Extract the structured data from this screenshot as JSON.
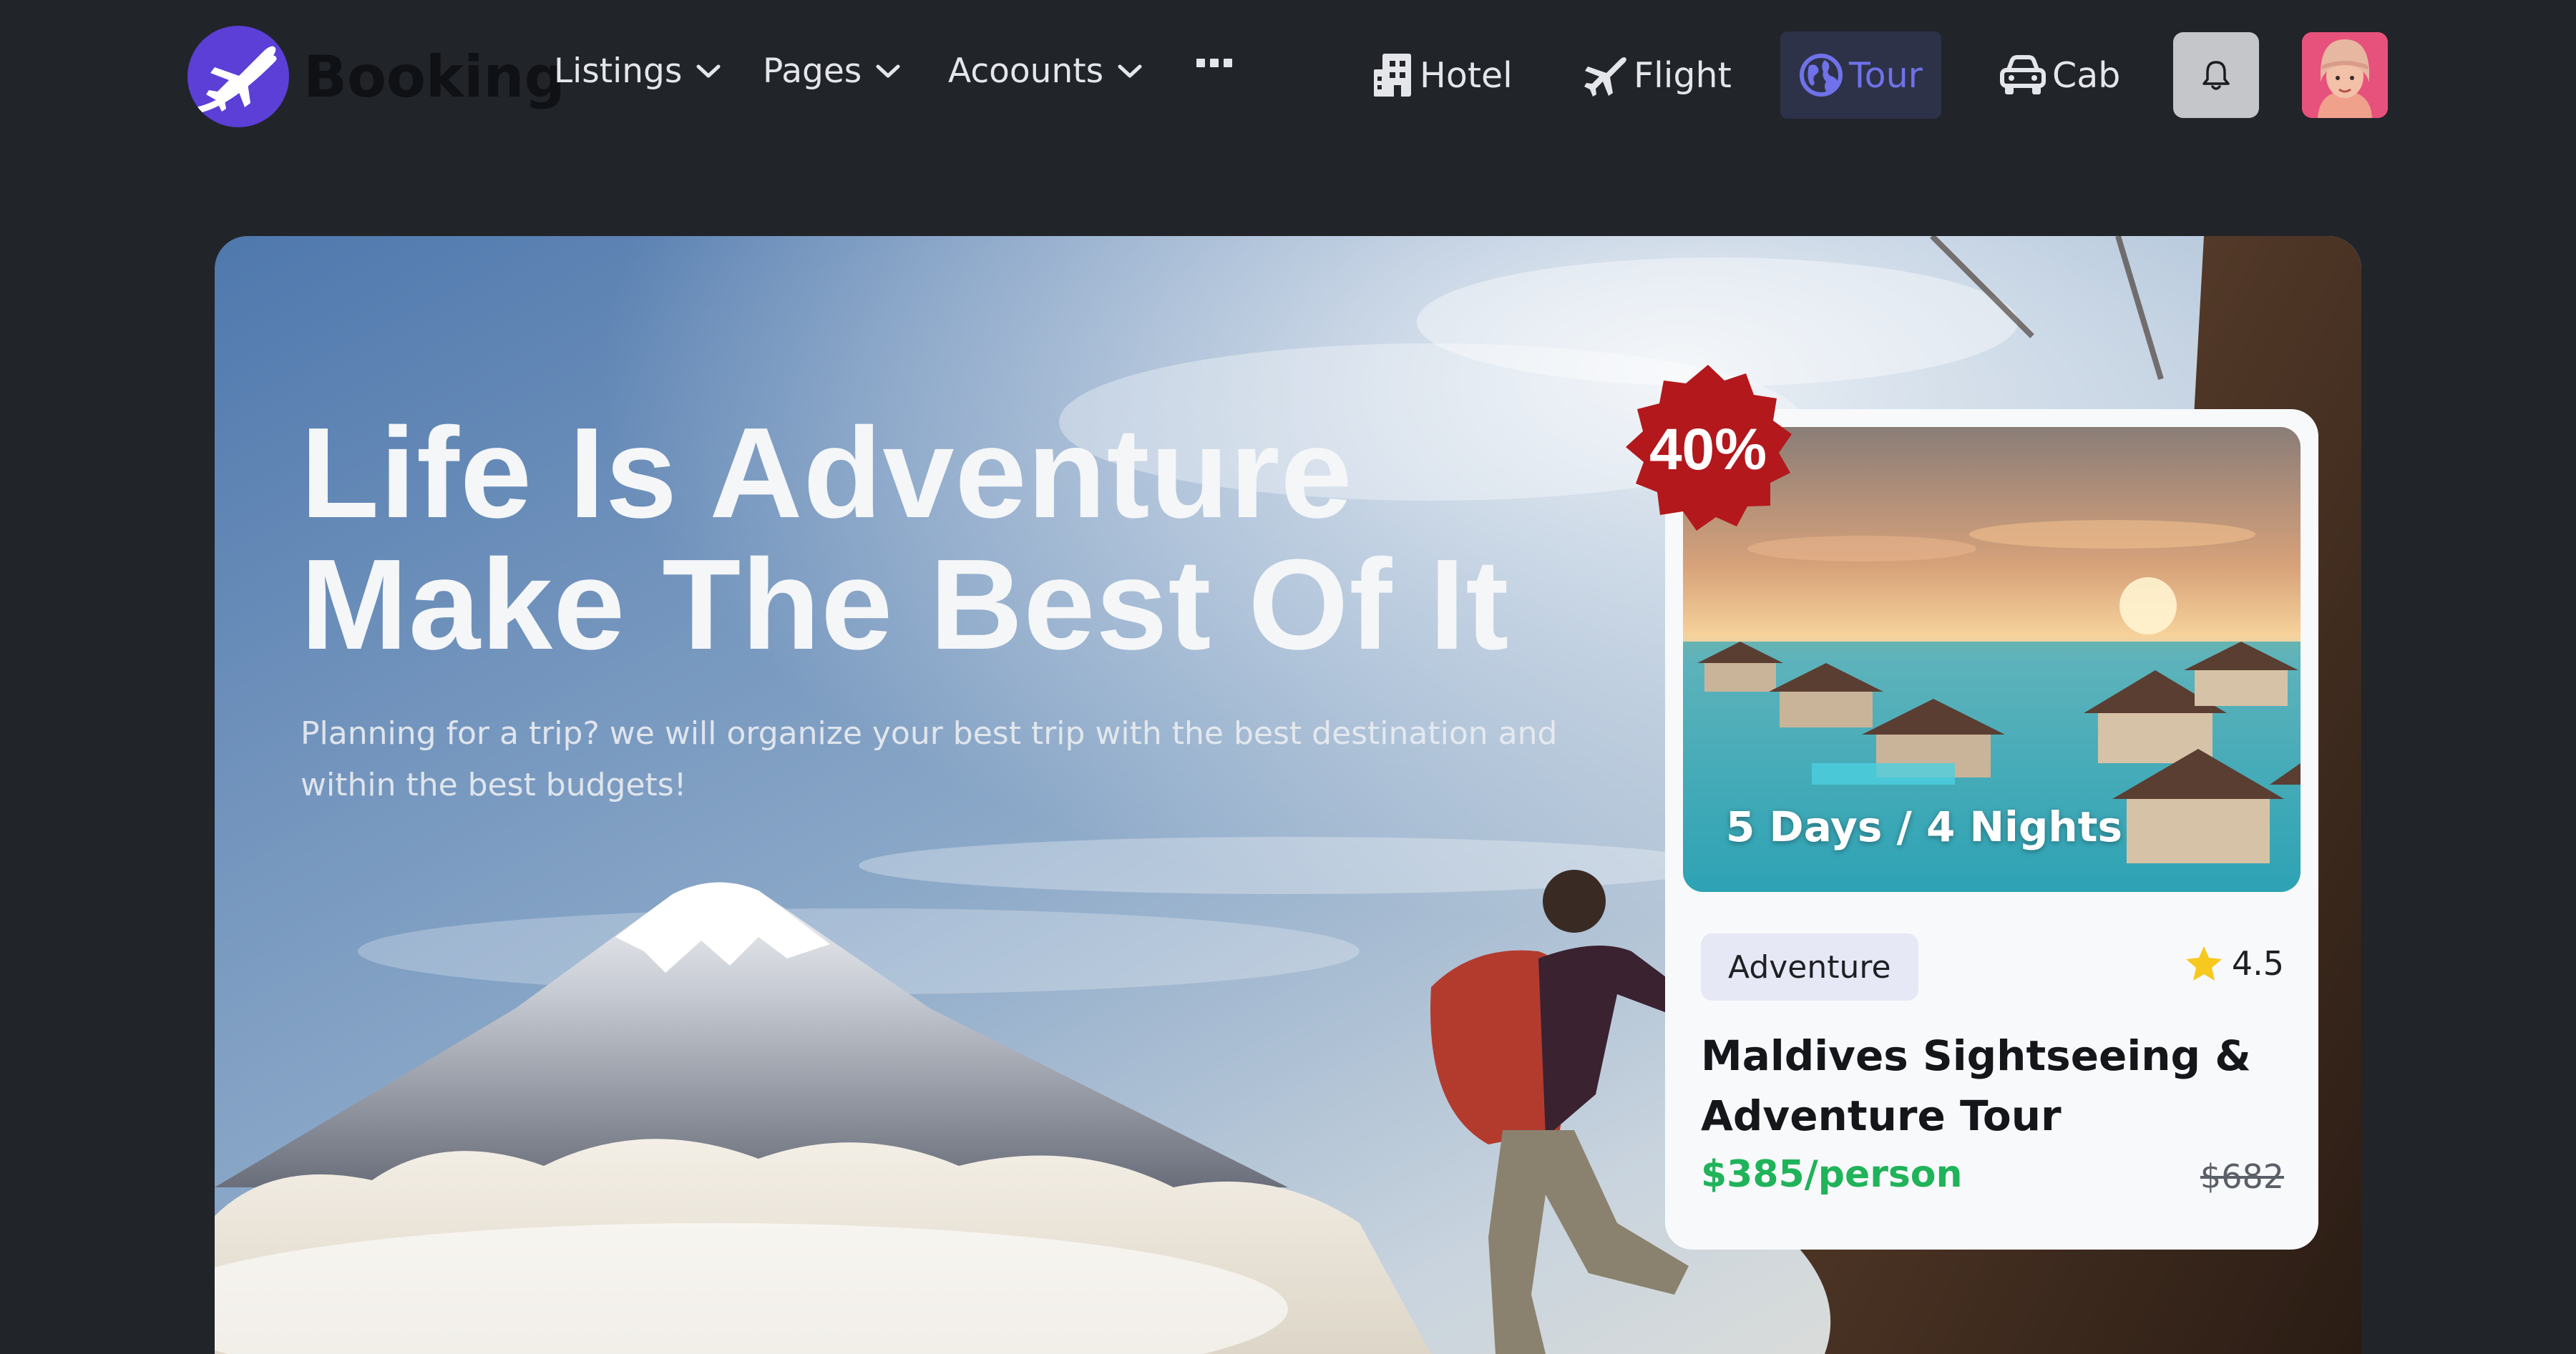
{
  "brand": {
    "name": "Booking"
  },
  "nav": {
    "menus": [
      {
        "label": "Listings"
      },
      {
        "label": "Pages"
      },
      {
        "label": "Acoounts"
      }
    ],
    "categories": [
      {
        "label": "Hotel",
        "icon": "building-icon"
      },
      {
        "label": "Flight",
        "icon": "plane-icon"
      },
      {
        "label": "Tour",
        "icon": "globe-icon",
        "active": true
      },
      {
        "label": "Cab",
        "icon": "car-icon"
      }
    ]
  },
  "hero": {
    "title_line1": "Life Is Adventure",
    "title_line2": "Make The Best Of It",
    "subtitle": "Planning for a trip? we will organize your best trip with the best destination and within the best budgets!"
  },
  "offer_card": {
    "discount": "40%",
    "duration": "5 Days / 4 Nights",
    "tag": "Adventure",
    "rating": "4.5",
    "title": "Maldives Sightseeing & Adventure Tour",
    "price": "$385/person",
    "old_price": "$682"
  },
  "colors": {
    "page_bg": "#212429",
    "accent": "#5b3fd6",
    "active_tab_text": "#6f72e8",
    "badge_red": "#b3181c",
    "price_green": "#20b35a"
  }
}
